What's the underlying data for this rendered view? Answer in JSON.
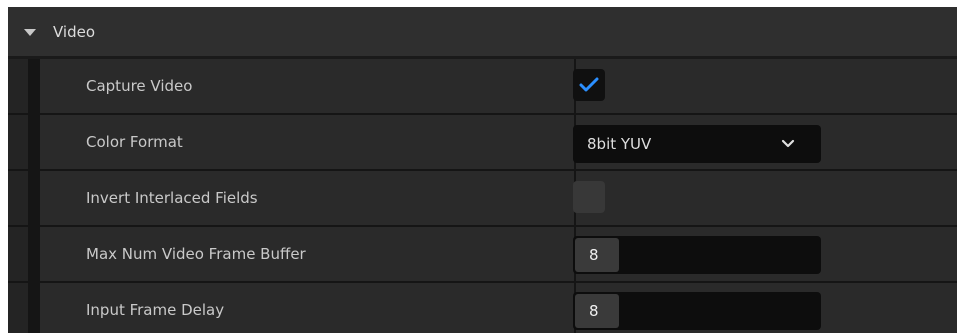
{
  "section": {
    "title": "Video",
    "expanded": true
  },
  "properties": [
    {
      "label": "Capture Video",
      "type": "checkbox",
      "checked": true
    },
    {
      "label": "Color Format",
      "type": "dropdown",
      "value": "8bit YUV"
    },
    {
      "label": "Invert Interlaced Fields",
      "type": "checkbox",
      "checked": false
    },
    {
      "label": "Max Num Video Frame Buffer",
      "type": "number",
      "value": "8"
    },
    {
      "label": "Input Frame Delay",
      "type": "number",
      "value": "8"
    }
  ],
  "colors": {
    "check_accent": "#2b8fff",
    "panel_bg": "#2a2a2a",
    "header_bg": "#2f2f2f"
  }
}
